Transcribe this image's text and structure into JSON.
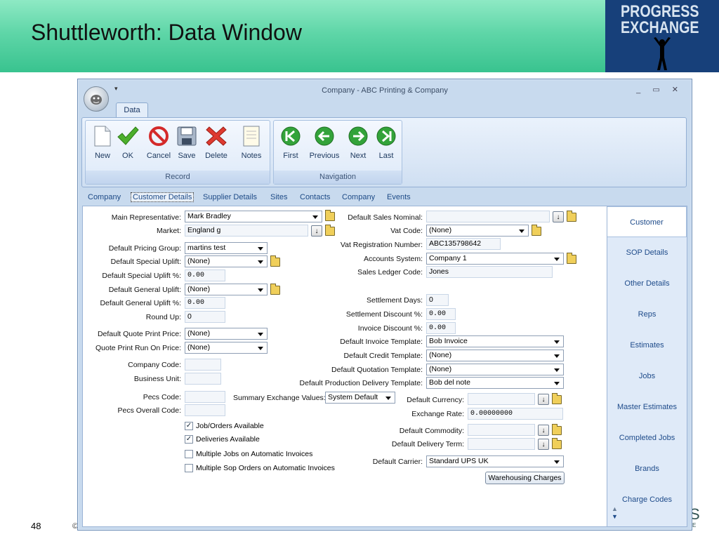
{
  "slide": {
    "title": "Shuttleworth: Data Window",
    "number": "48",
    "copyright": "©",
    "logo_line1": "PROGRESS",
    "logo_line2": "EXCHANGE",
    "peek": "S",
    "peek_small": "E"
  },
  "window": {
    "title": "Company - ABC Printing & Company",
    "tab": "Data",
    "qat": "▾",
    "controls": "_ ▭ ✕"
  },
  "ribbon": {
    "record_label": "Record",
    "navigation_label": "Navigation",
    "new": "New",
    "ok": "OK",
    "cancel": "Cancel",
    "save": "Save",
    "delete": "Delete",
    "notes": "Notes",
    "first": "First",
    "previous": "Previous",
    "next": "Next",
    "last": "Last"
  },
  "subtabs": [
    "Company",
    "Customer Details",
    "Supplier Details",
    "Sites",
    "Contacts",
    "Company",
    "Events"
  ],
  "right_tabs": [
    "Customer",
    "SOP Details",
    "Other Details",
    "Reps",
    "Estimates",
    "Jobs",
    "Master Estimates",
    "Completed Jobs",
    "Brands",
    "Charge Codes"
  ],
  "left": {
    "main_rep_label": "Main Representative:",
    "main_rep": "Mark Bradley",
    "market_label": "Market:",
    "market": "England g",
    "pricing_group_label": "Default Pricing Group:",
    "pricing_group": "martins test",
    "special_uplift_label": "Default Special Uplift:",
    "special_uplift": "(None)",
    "special_uplift_pct_label": "Default Special Uplift %:",
    "special_uplift_pct": "0.00",
    "general_uplift_label": "Default General Uplift:",
    "general_uplift": "(None)",
    "general_uplift_pct_label": "Default General Uplift %:",
    "general_uplift_pct": "0.00",
    "round_up_label": "Round Up:",
    "round_up": "0",
    "quote_print_price_label": "Default Quote Print Price:",
    "quote_print_price": "(None)",
    "quote_run_on_label": "Quote Print Run On Price:",
    "quote_run_on": "(None)",
    "company_code_label": "Company Code:",
    "company_code": "",
    "business_unit_label": "Business Unit:",
    "business_unit": "",
    "pecs_code_label": "Pecs Code:",
    "pecs_code": "",
    "pecs_overall_label": "Pecs Overall Code:",
    "pecs_overall": "",
    "summary_label": "Summary Exchange Values:",
    "summary": "System Default",
    "checks": [
      {
        "label": "Job/Orders Available",
        "checked": true
      },
      {
        "label": "Deliveries Available",
        "checked": true
      },
      {
        "label": "Multiple Jobs on Automatic Invoices",
        "checked": false
      },
      {
        "label": "Multiple Sop Orders on Automatic Invoices",
        "checked": false
      }
    ]
  },
  "right": {
    "sales_nominal_label": "Default Sales Nominal:",
    "sales_nominal": "",
    "vat_code_label": "Vat Code:",
    "vat_code": "(None)",
    "vat_reg_label": "Vat Registration Number:",
    "vat_reg": "ABC135798642",
    "accounts_system_label": "Accounts System:",
    "accounts_system": "Company 1",
    "sales_ledger_label": "Sales Ledger Code:",
    "sales_ledger": "Jones",
    "settlement_days_label": "Settlement Days:",
    "settlement_days": "0",
    "settlement_disc_label": "Settlement Discount %:",
    "settlement_disc": "0.00",
    "invoice_disc_label": "Invoice Discount %:",
    "invoice_disc": "0.00",
    "invoice_template_label": "Default Invoice Template:",
    "invoice_template": "Bob Invoice",
    "credit_template_label": "Default Credit Template:",
    "credit_template": "(None)",
    "quotation_template_label": "Default Quotation Template:",
    "quotation_template": "(None)",
    "prod_delivery_label": "Default Production Delivery Template:",
    "prod_delivery": "Bob del note",
    "currency_label": "Default Currency:",
    "currency": "",
    "exchange_rate_label": "Exchange Rate:",
    "exchange_rate": "0.00000000",
    "commodity_label": "Default Commodity:",
    "commodity": "",
    "delivery_term_label": "Default Delivery Term:",
    "delivery_term": "",
    "carrier_label": "Default Carrier:",
    "carrier": "Standard UPS UK",
    "warehousing_button": "Warehousing Charges"
  }
}
